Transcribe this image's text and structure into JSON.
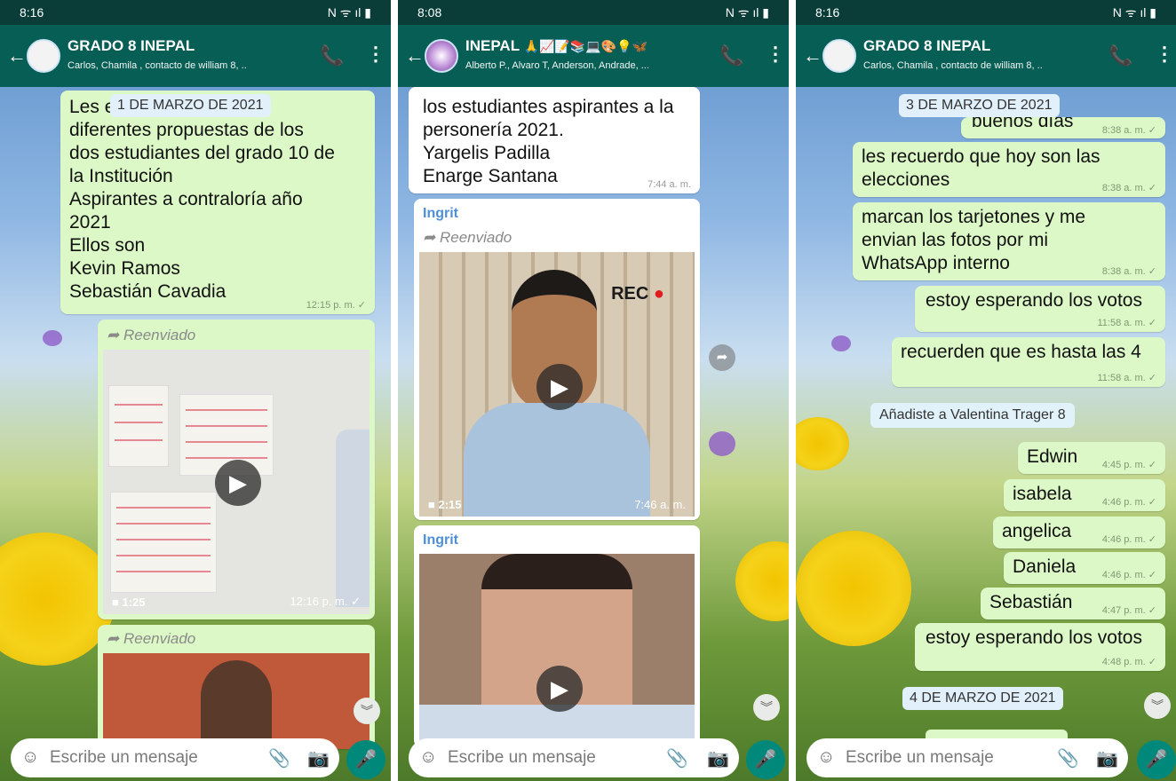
{
  "panel1": {
    "status_time": "8:16",
    "status_icons": "N ᯤ ıl ▮",
    "title": "GRADO 8 INEPAL",
    "subtitle": "Carlos, Chamila , contacto de william 8, ..",
    "date_chip": "1 DE MARZO DE 2021",
    "message1_text": "Les e           n las\ndiferentes  propuestas de los\ndos estudiantes  del grado 10 de\nla Institución\nAspirantes  a contraloría  año\n2021\nEllos son\nKevin  Ramos\nSebastián  Cavadia",
    "message1_time": "12:15 p. m. ✓",
    "forwarded_label": "Reenviado",
    "video1_duration": "1:25",
    "video1_time": "12:16 p. m. ✓",
    "forwarded_label2": "Reenviado",
    "placeholder": "Escribe un mensaje"
  },
  "panel2": {
    "status_time": "8:08",
    "status_icons": "N ᯤ ıl ▮",
    "title": "INEPAL",
    "title_emoji": "🙏📈📝📚💻🎨💡🦋",
    "subtitle": "Alberto P., Alvaro T, Anderson, Andrade, ...",
    "message1_text": "los estudiantes aspirantes a la\npersonería 2021.\nYargelis Padilla\nEnarge Santana",
    "message1_time": "7:44 a. m.",
    "sender1": "Ingrit",
    "forwarded_label": "Reenviado",
    "rec_label": "REC",
    "video1_duration": "2:15",
    "video1_time": "7:46 a. m.",
    "sender2": "Ingrit",
    "placeholder": "Escribe un mensaje"
  },
  "panel3": {
    "status_time": "8:16",
    "status_icons": "N ᯤ ıl ▮",
    "title": "GRADO 8 INEPAL",
    "subtitle": "Carlos, Chamila , contacto de william 8, ..",
    "date_chip1": "3 DE MARZO DE 2021",
    "msg0_text": "buenos días",
    "msg0_time": "8:38 a. m. ✓",
    "messages": [
      {
        "text": "les recuerdo que hoy son las\nelecciones",
        "time": "8:38 a. m. ✓"
      },
      {
        "text": "marcan los tarjetones y me\nenvian las fotos por mi\nWhatsApp interno",
        "time": "8:38 a. m. ✓"
      },
      {
        "text": "estoy esperando los votos",
        "time": "11:58 a. m. ✓"
      },
      {
        "text": "recuerden que es hasta las 4",
        "time": "11:58 a. m. ✓"
      }
    ],
    "system_message": "Añadiste a Valentina Trager 8",
    "names": [
      {
        "text": "Edwin",
        "time": "4:45 p. m. ✓"
      },
      {
        "text": "isabela",
        "time": "4:46 p. m. ✓"
      },
      {
        "text": "angelica",
        "time": "4:46 p. m. ✓"
      },
      {
        "text": "Daniela",
        "time": "4:46 p. m. ✓"
      },
      {
        "text": "Sebastián",
        "time": "4:47 p. m. ✓"
      }
    ],
    "last_msg_text": "estoy esperando los votos",
    "last_msg_time": "4:48 p. m. ✓",
    "date_chip2": "4 DE MARZO DE 2021",
    "placeholder": "Escribe un mensaje"
  },
  "icons": {
    "back": "arrow-left-icon",
    "call": "add-call-icon",
    "menu": "more-vertical-icon",
    "emoji": "emoji-icon",
    "attach": "paperclip-icon",
    "camera": "camera-icon",
    "mic": "microphone-icon",
    "forward": "forward-arrow-icon",
    "play": "play-icon",
    "scroll": "chevron-double-down-icon"
  },
  "colors": {
    "appbar": "#075e54",
    "statusbar": "#0a3d38",
    "outgoing_bubble": "#dcf8c6",
    "incoming_bubble": "#ffffff",
    "mic_button": "#00897b",
    "sender_name": "#4e8fd6"
  }
}
